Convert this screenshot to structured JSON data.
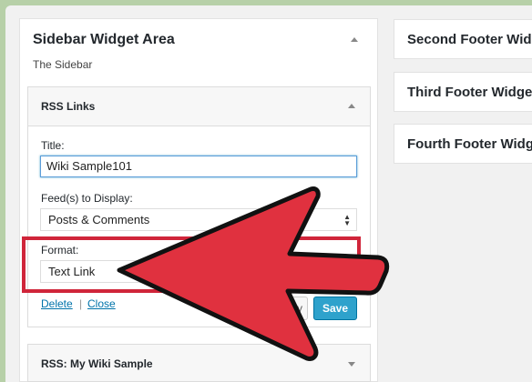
{
  "sidebar_area": {
    "title": "Sidebar Widget Area",
    "description": "The Sidebar"
  },
  "rss_widget": {
    "title": "RSS Links",
    "title_label": "Title:",
    "title_value": "Wiki Sample101",
    "feeds_label": "Feed(s) to Display:",
    "feeds_value": "Posts & Comments",
    "format_label": "Format:",
    "format_value": "Text Link",
    "delete_label": "Delete",
    "separator": "|",
    "close_label": "Close",
    "secondary_button_fragment": "y",
    "save_label": "Save"
  },
  "rss_widget_2": {
    "title": "RSS: My Wiki Sample"
  },
  "footer_areas": [
    {
      "title": "Second Footer Widget Area"
    },
    {
      "title": "Third Footer Widget Area"
    },
    {
      "title": "Fourth Footer Widget Area"
    }
  ],
  "colors": {
    "arrow_fill": "#e0313f",
    "arrow_stroke": "#111111",
    "highlight_box": "#d0253a",
    "primary_button": "#2ea2cc",
    "link": "#0073aa"
  },
  "icons": {
    "collapse": "caret-up-icon",
    "expand": "caret-down-icon",
    "select": "select-arrows-icon",
    "pointer": "arrow-pointer-icon"
  }
}
